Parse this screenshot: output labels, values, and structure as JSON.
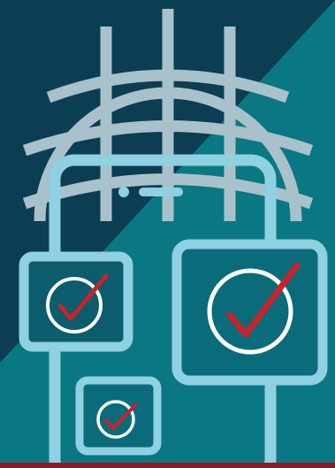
{
  "illustration": {
    "subject": "",
    "elements": {
      "globe": "globe-icon",
      "phone": "smartphone-icon",
      "tiles": [
        "checkmark-tile-icon",
        "checkmark-tile-icon",
        "checkmark-tile-icon"
      ],
      "check": "checkmark-icon"
    }
  },
  "colors": {
    "background_dark": "#0b3e52",
    "background_teal": "#0a7883",
    "globe_stroke": "#a9c1cb",
    "light_blue": "#8fd0e2",
    "check_ring": "#ffffff",
    "check_mark": "#c8232c",
    "bottom_bar": "#8b1a24"
  }
}
